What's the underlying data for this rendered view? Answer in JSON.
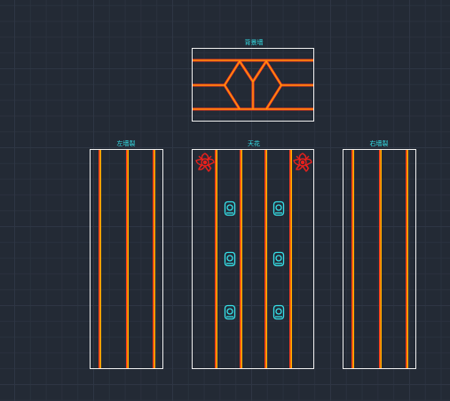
{
  "drawing": {
    "background_color": "#232a35",
    "stroke_colors": {
      "frame": "#f0f0f0",
      "panel_line": "#ff7a00",
      "title": "#36e2ea",
      "lamp": "#36e2ea",
      "plant": "#e8201c"
    },
    "panels": {
      "background_wall": {
        "title": "背景墙"
      },
      "left_wall": {
        "title": "左墙裂"
      },
      "ceiling": {
        "title": "天花"
      },
      "right_wall": {
        "title": "右墙裂"
      }
    },
    "ceiling_fixtures": {
      "lamp_icon": "ceiling-lamp-icon",
      "lamp_count": 6,
      "plant_icon": "potted-plant-icon",
      "plant_count": 2
    }
  }
}
